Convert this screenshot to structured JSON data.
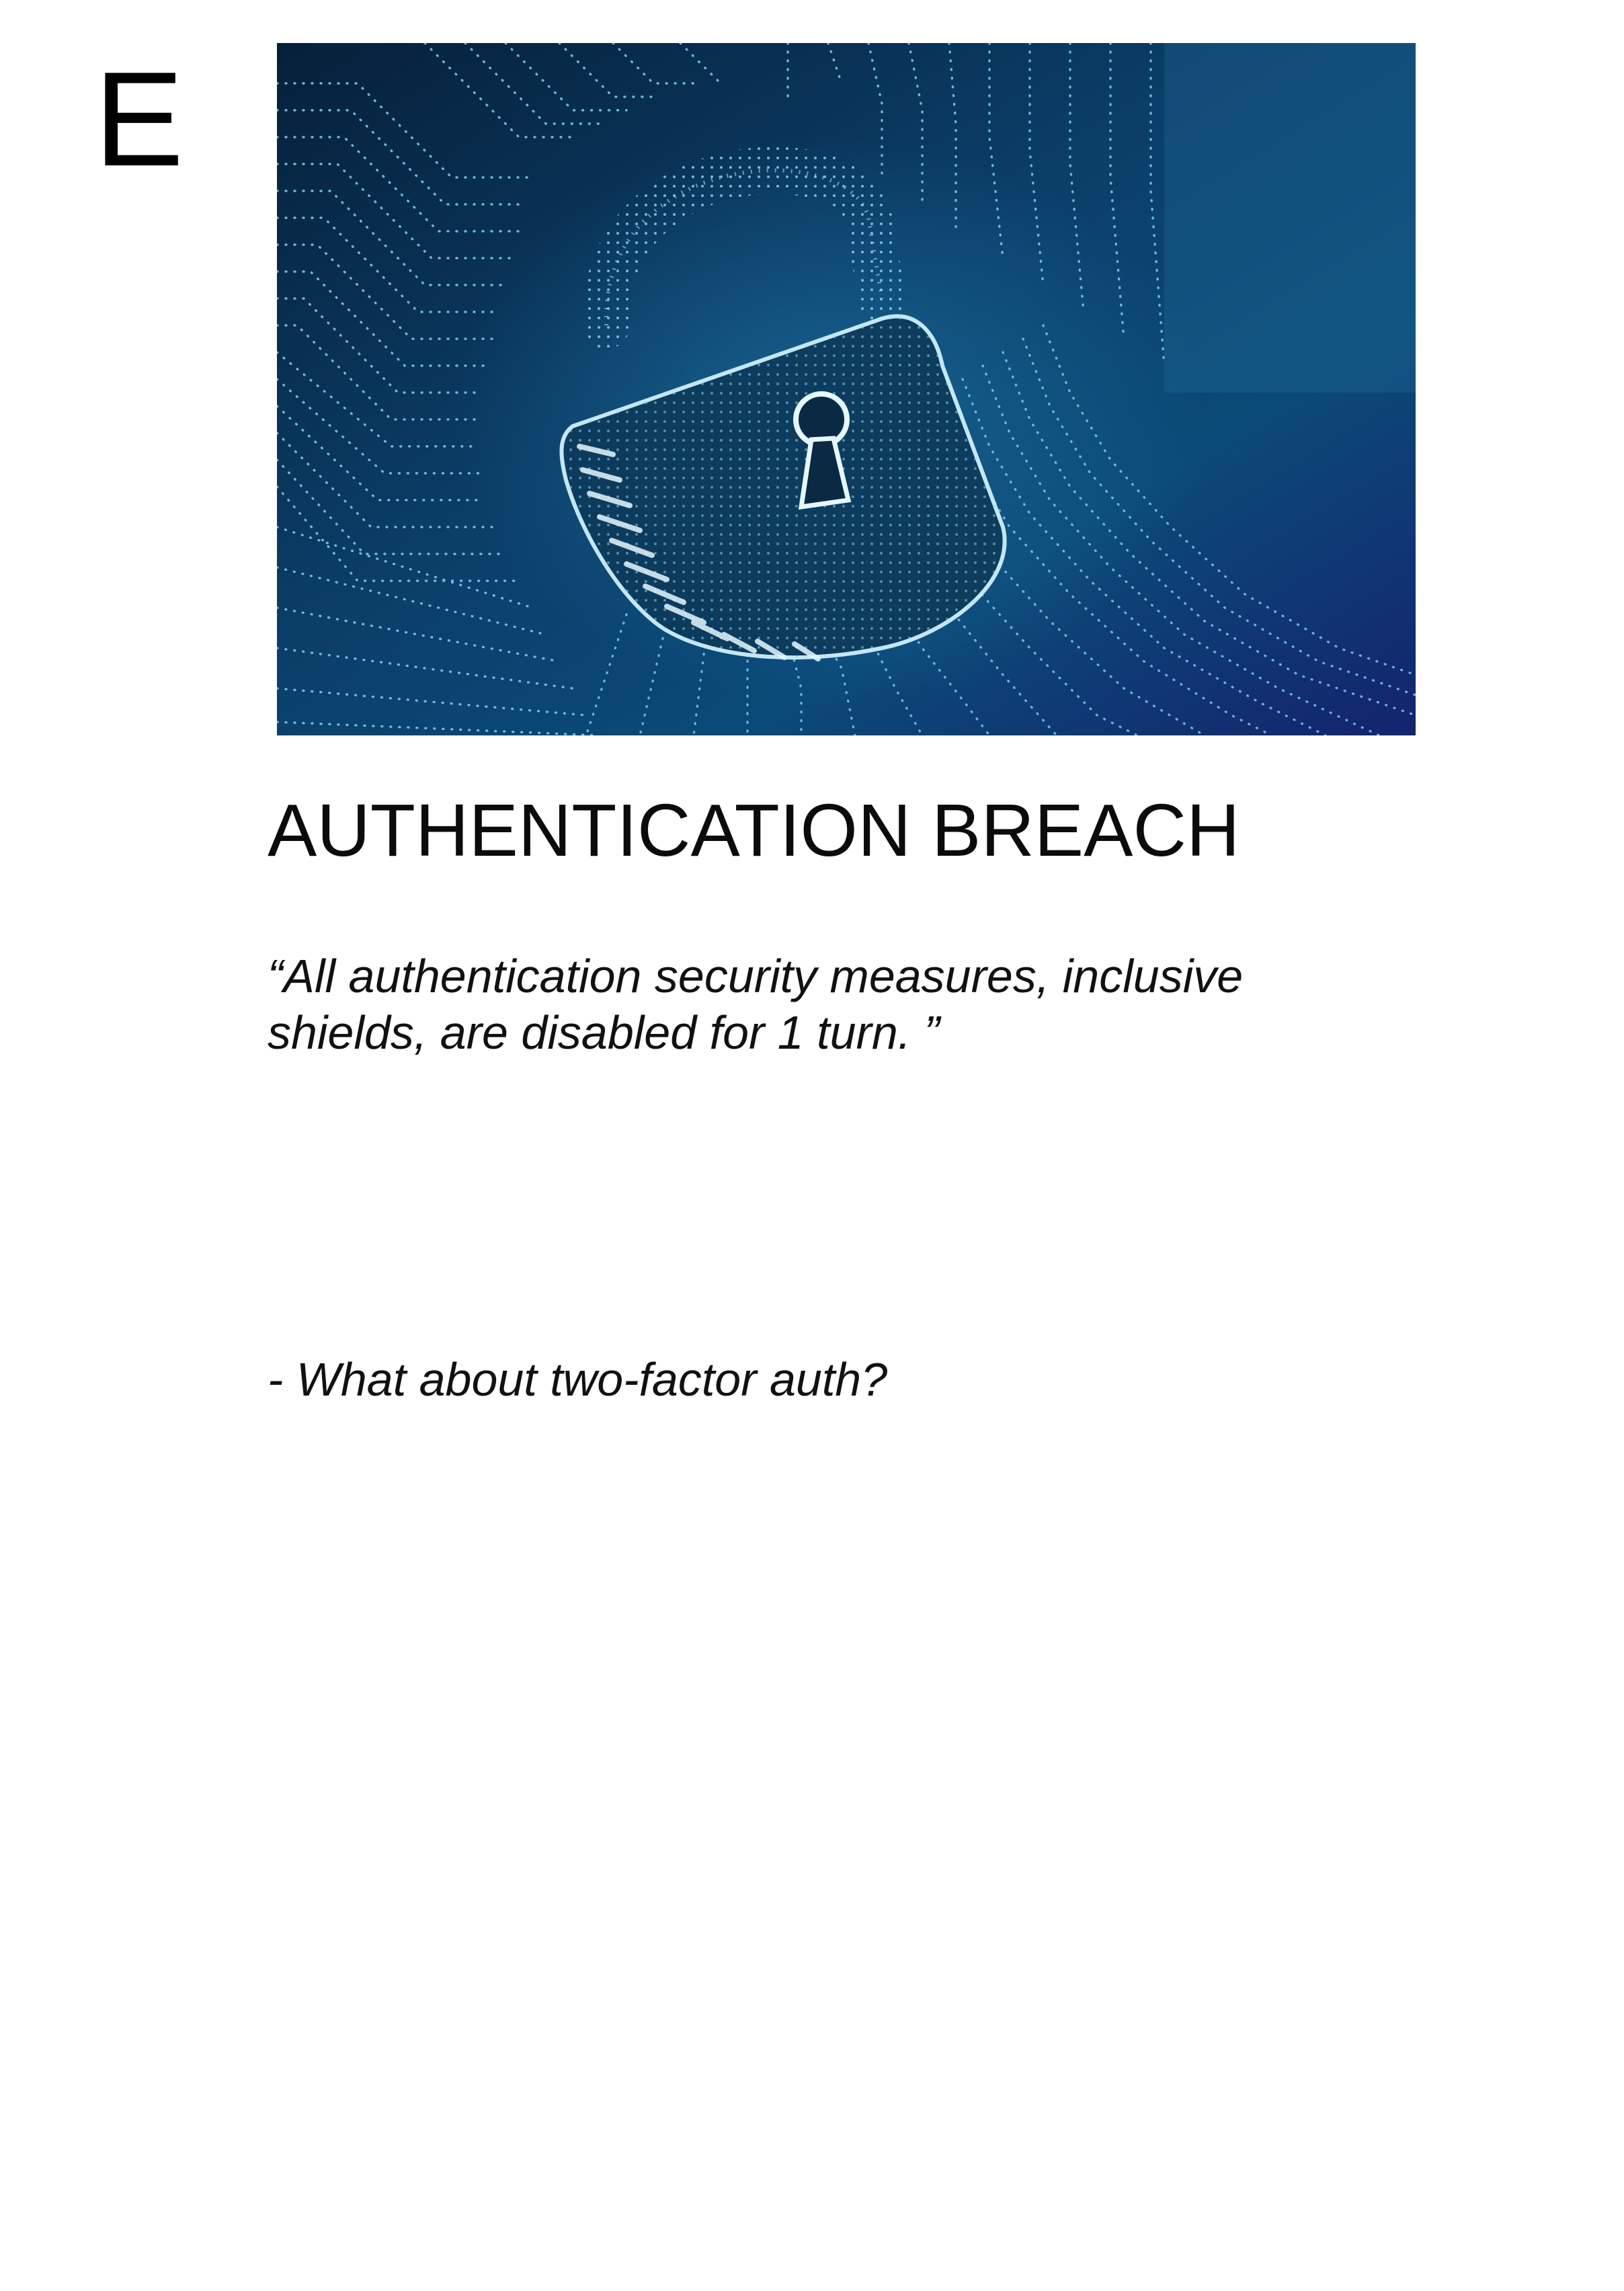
{
  "card": {
    "corner_letter": "E",
    "image": {
      "subject": "padlock-icon",
      "colors": {
        "background_dark": "#06203a",
        "background_mid": "#0b4a78",
        "background_deep": "#14236e",
        "dots": "#7fd3f0",
        "lock_glow": "#cfefff"
      }
    },
    "title": "AUTHENTICATION BREACH",
    "quote_line_1": "“All authentication security measures, inclusive",
    "quote_line_2": "shields, are disabled for 1 turn. ”",
    "question": "- What about two-factor auth?"
  }
}
